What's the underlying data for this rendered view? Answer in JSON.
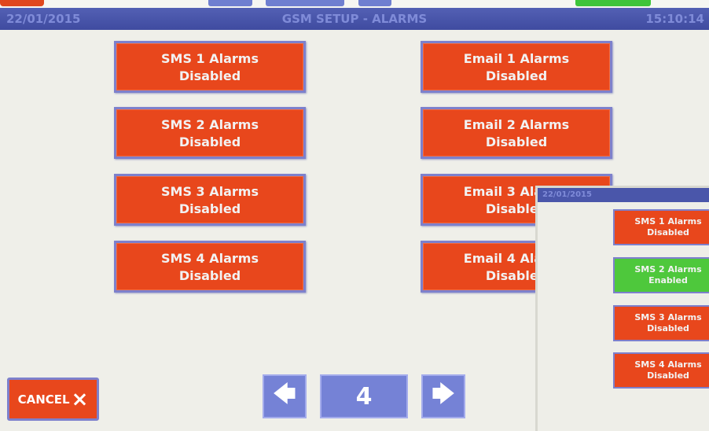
{
  "header": {
    "date": "22/01/2015",
    "title": "GSM SETUP - ALARMS",
    "time": "15:10:14"
  },
  "sms_buttons": [
    {
      "label": "SMS 1 Alarms",
      "status": "Disabled"
    },
    {
      "label": "SMS 2 Alarms",
      "status": "Disabled"
    },
    {
      "label": "SMS 3 Alarms",
      "status": "Disabled"
    },
    {
      "label": "SMS 4 Alarms",
      "status": "Disabled"
    }
  ],
  "email_buttons": [
    {
      "label": "Email 1 Alarms",
      "status": "Disabled"
    },
    {
      "label": "Email 2 Alarms",
      "status": "Disabled"
    },
    {
      "label": "Email 3 Alarms",
      "status": "Disabled"
    },
    {
      "label": "Email 4 Alarms",
      "status": "Disabled"
    }
  ],
  "footer": {
    "cancel_label": "CANCEL",
    "cancel_icon": "×",
    "prev_icon": "🡄",
    "page_number": "4",
    "next_icon": "🡆"
  },
  "inset": {
    "date": "22/01/2015",
    "buttons": [
      {
        "label": "SMS 1 Alarms",
        "status": "Disabled",
        "color": "#e8471c"
      },
      {
        "label": "SMS 2 Alarms",
        "status": "Enabled",
        "color": "#4ec83c"
      },
      {
        "label": "SMS 3 Alarms",
        "status": "Disabled",
        "color": "#e8471c"
      },
      {
        "label": "SMS 4 Alarms",
        "status": "Disabled",
        "color": "#e8471c"
      }
    ]
  },
  "colors": {
    "button_red": "#e8471c",
    "button_green": "#4ec83c",
    "title_bar": "#4a56aa",
    "nav_blue": "#7582d6",
    "background": "#efefe9"
  }
}
